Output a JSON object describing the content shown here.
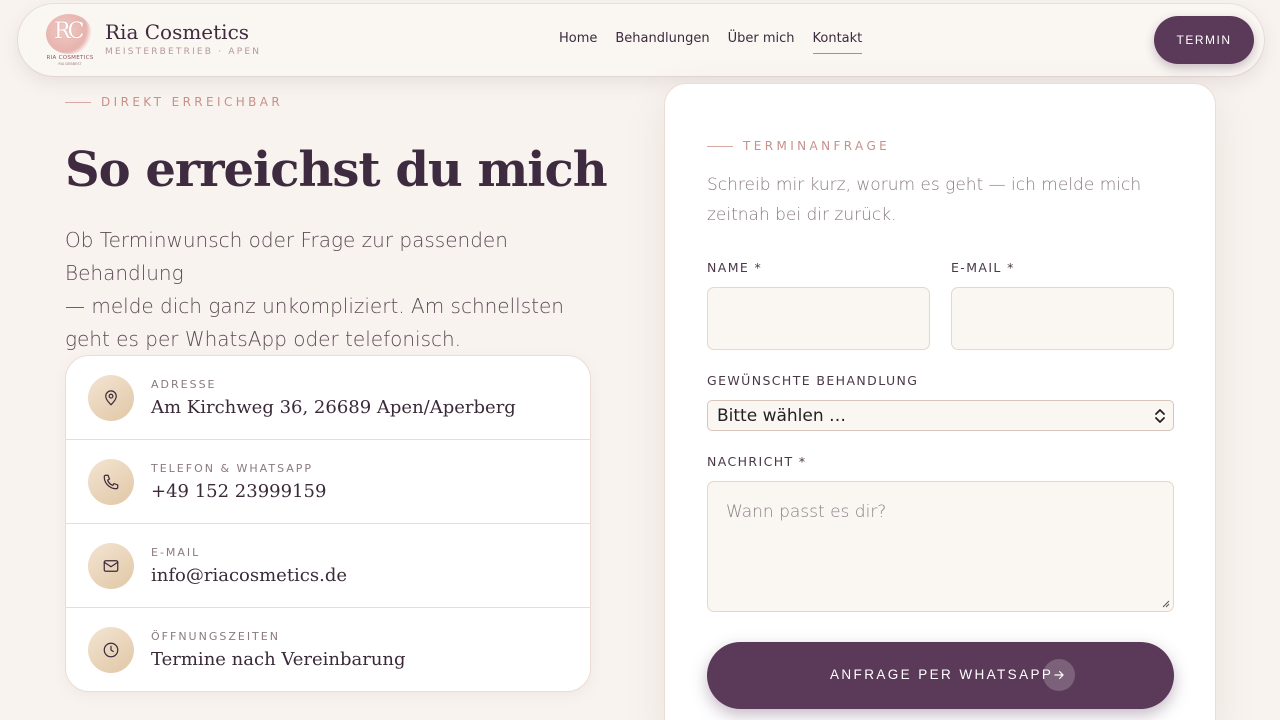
{
  "brand": {
    "name": "Ria Cosmetics",
    "subtitle": "MEISTERBETRIEB · APEN",
    "logo_letters": "RC",
    "logo_small_text": "RIA COSMETICS",
    "logo_tiny_text": "RIA DEBBEST"
  },
  "nav": {
    "items": [
      {
        "label": "Home"
      },
      {
        "label": "Behandlungen"
      },
      {
        "label": "Über mich"
      },
      {
        "label": "Kontakt"
      }
    ],
    "active": "Kontakt",
    "cta_label": "TERMIN"
  },
  "hero": {
    "eyebrow": "DIREKT ERREICHBAR",
    "title": "So erreichst du mich",
    "text_lines": [
      "Ob Terminwunsch oder Frage zur passenden Behandlung",
      "— melde dich ganz unkompliziert. Am schnellsten",
      "geht es per WhatsApp oder telefonisch."
    ]
  },
  "contact": {
    "items": [
      {
        "label": "ADRESSE",
        "value": "Am Kirchweg 36, 26689 Apen/Aperberg",
        "icon": "map-pin-icon"
      },
      {
        "label": "TELEFON & WHATSAPP",
        "value": "+49 152 23999159",
        "icon": "phone-icon"
      },
      {
        "label": "E-MAIL",
        "value": "info@riacosmetics.de",
        "icon": "mail-icon"
      },
      {
        "label": "ÖFFNUNGSZEITEN",
        "value": "Termine nach Vereinbarung",
        "icon": "clock-icon"
      }
    ]
  },
  "form": {
    "eyebrow": "TERMINANFRAGE",
    "intro_lines": [
      "Schreib mir kurz, worum es geht — ich melde mich",
      "zeitnah bei dir zurück."
    ],
    "name_label": "NAME *",
    "name_value": "",
    "email_label": "E-MAIL *",
    "email_value": "",
    "treatment_label": "GEWÜNSCHTE BEHANDLUNG",
    "treatment_value": "Bitte wählen …",
    "message_label": "NACHRICHT *",
    "message_placeholder": "Wann passt es dir?",
    "submit_label": "ANFRAGE PER WHATSAPP"
  },
  "colors": {
    "background": "#f8f3ef",
    "accent": "#5a3a58",
    "eyebrow": "#c7918a",
    "heading": "#3f2b40"
  }
}
